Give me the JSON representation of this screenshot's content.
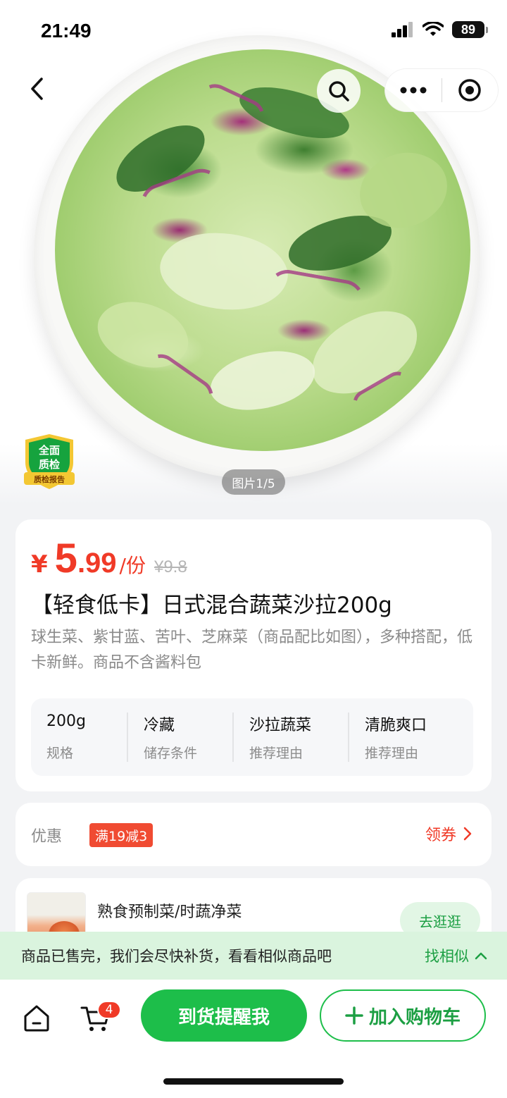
{
  "status_bar": {
    "time": "21:49",
    "battery": "89"
  },
  "header": {
    "back_icon": "chevron-left-icon",
    "search_icon": "search-icon",
    "more_icon": "more-dots-icon",
    "close_icon": "target-close-icon"
  },
  "gallery": {
    "image_counter": "图片1/5",
    "badge": {
      "line1": "全面",
      "line2": "质检",
      "line3": "质检报告"
    }
  },
  "product": {
    "currency": "¥",
    "price_int": "5",
    "price_dec": ".99",
    "price_unit": "/份",
    "original_price": "¥9.8",
    "title": "【轻食低卡】日式混合蔬菜沙拉200g",
    "description": "球生菜、紫甘蓝、苦叶、芝麻菜（商品配比如图），多种搭配，低卡新鲜。商品不含酱料包",
    "specs": [
      {
        "value": "200g",
        "key": "规格"
      },
      {
        "value": "冷藏",
        "key": "储存条件"
      },
      {
        "value": "沙拉蔬菜",
        "key": "推荐理由"
      },
      {
        "value": "清脆爽口",
        "key": "推荐理由"
      }
    ]
  },
  "coupon": {
    "label": "优惠",
    "tag": "满19减3",
    "get_label": "领券"
  },
  "recommend": {
    "title": "熟食预制菜/时蔬净菜",
    "button": "去逛逛"
  },
  "soldout": {
    "text": "商品已售完，我们会尽快补货，看看相似商品吧",
    "find_label": "找相似"
  },
  "bottom_bar": {
    "cart_count": "4",
    "notify_label": "到货提醒我",
    "add_cart_label": "加入购物车"
  },
  "colors": {
    "accent_green": "#1dbe4a",
    "price_red": "#f03a27"
  }
}
